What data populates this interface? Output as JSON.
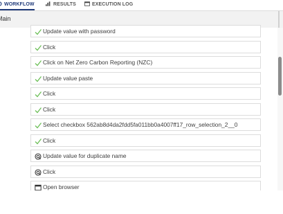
{
  "tabs": [
    {
      "label": "WORKFLOW",
      "icon": "workflow-icon",
      "active": true
    },
    {
      "label": "RESULTS",
      "icon": "chart-icon",
      "active": false
    },
    {
      "label": "EXECUTION LOG",
      "icon": "log-icon",
      "active": false
    }
  ],
  "subheader": {
    "title": "Main"
  },
  "steps": [
    {
      "label": "Update value with password",
      "status": "check"
    },
    {
      "label": "Click",
      "status": "check"
    },
    {
      "label": "Click on Net Zero Carbon Reporting (NZC)",
      "status": "check"
    },
    {
      "label": "Update value paste",
      "status": "check"
    },
    {
      "label": "Click",
      "status": "check"
    },
    {
      "label": "Click",
      "status": "check"
    },
    {
      "label": "Select checkbox 562ab8d4da2fdd5fa011bb0a4007ff17_row_selection_2__0",
      "status": "check"
    },
    {
      "label": "Click",
      "status": "check"
    },
    {
      "label": "Update value for duplicate name",
      "status": "pending"
    },
    {
      "label": "Click",
      "status": "pending"
    },
    {
      "label": "Open browser",
      "status": "browser"
    }
  ],
  "colors": {
    "check": "#6cbf57",
    "tab_active": "#1f3a7a"
  }
}
